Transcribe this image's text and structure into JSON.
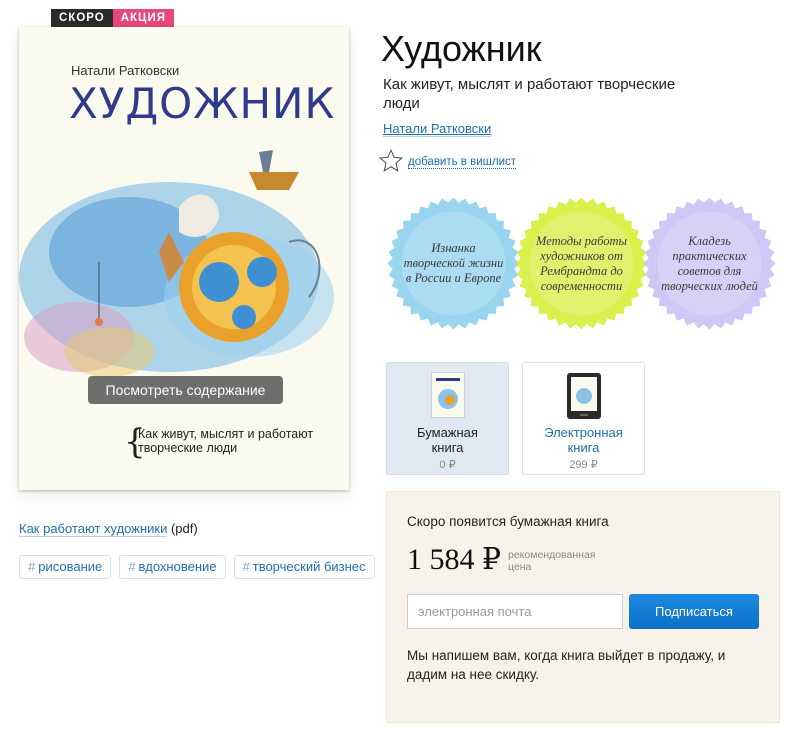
{
  "badges": {
    "soon": "СКОРО",
    "sale": "АКЦИЯ"
  },
  "cover": {
    "author": "Натали Ратковски",
    "title": "ХУДОЖНИК",
    "preview_button": "Посмотреть содержание",
    "subtitle_line1": "Как живут, мыслят и работают",
    "subtitle_line2": "творческие люди"
  },
  "left": {
    "how_link": "Как работают художники",
    "how_link_suffix": " (pdf)",
    "tags": [
      "рисование",
      "вдохновение",
      "творческий бизнес"
    ]
  },
  "book": {
    "title": "Художник",
    "subtitle": "Как живут, мыслят и работают творческие люди",
    "author": "Натали Ратковски",
    "wishlist": "добавить в вишлист"
  },
  "stickers": [
    {
      "text": "Изнанка творческой жизни в России и Европе",
      "color": "#8fd0ee"
    },
    {
      "text": "Методы работы художников от Рембрандта до современности",
      "color": "#d6ee3a"
    },
    {
      "text": "Кладезь практических советов для творческих людей",
      "color": "#c9c2f5"
    }
  ],
  "formats": {
    "paper": {
      "label_line1": "Бумажная",
      "label_line2": "книга",
      "price": "0 ₽"
    },
    "ebook": {
      "label_line1": "Электронная",
      "label_line2": "книга",
      "price": "299 ₽"
    }
  },
  "subscribe": {
    "heading": "Скоро появится бумажная книга",
    "price": "1 584 ₽",
    "price_note_line1": "рекомендованная",
    "price_note_line2": "цена",
    "email_placeholder": "электронная почта",
    "button": "Подписаться",
    "note": "Мы напишем вам, когда книга выйдет в продажу, и дадим на нее скидку."
  },
  "colors": {
    "accent": "#1e6fb3",
    "sale_badge": "#e8477a",
    "soon_badge": "#2b2b2b",
    "cover_title": "#2f3a8c",
    "subscribe_bg": "#f8f3ea"
  }
}
